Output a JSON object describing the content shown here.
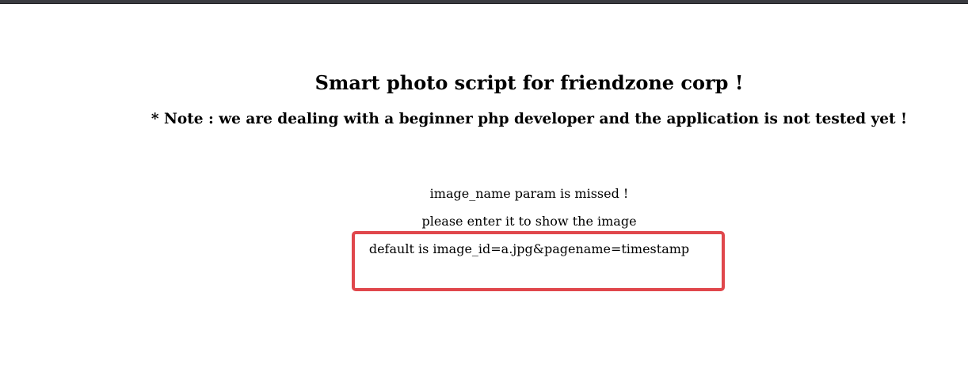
{
  "window": {
    "title": "Smart photo script for friendzone corp !",
    "note": "* Note : we are dealing with a beginner php developer and the application is not tested yet !"
  },
  "messages": {
    "missing": "image_name param is missed !",
    "enter": "please enter it to show the image",
    "default": "default is image_id=a.jpg&pagename=timestamp"
  },
  "colors": {
    "highlight": "#e0474c",
    "background": "#ffffff",
    "text": "#000000"
  }
}
